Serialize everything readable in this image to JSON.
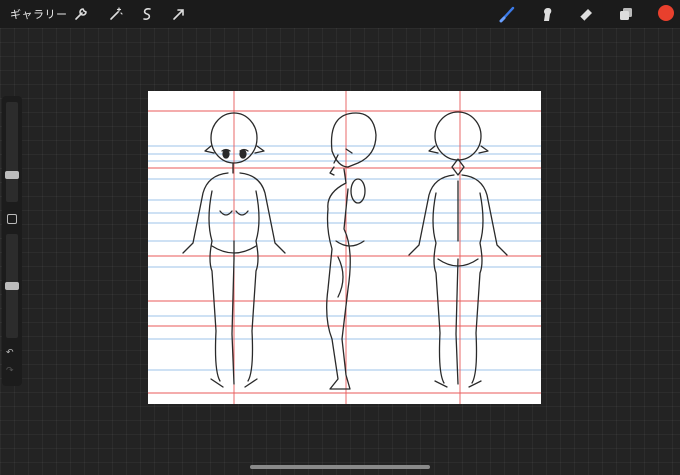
{
  "topbar": {
    "gallery_label": "ギャラリー",
    "tools_left": [
      "wrench-icon",
      "magic-wand-icon",
      "selection-icon",
      "transform-arrow-icon"
    ],
    "tools_right": [
      "brush-icon",
      "smudge-icon",
      "eraser-icon",
      "layers-icon"
    ],
    "active_tool": "brush-icon",
    "accent_color": "#3b7ae8",
    "current_color": "#e8402d"
  },
  "sidebar": {
    "brush_size_level": 0.25,
    "opacity_level": 0.5,
    "undo_icon": "undo-arrow-icon",
    "redo_icon": "redo-arrow-icon"
  },
  "canvas": {
    "guide_colors": {
      "red": "#e85a5a",
      "blue": "#9ec3ea",
      "sketch": "#2a2a2a"
    },
    "figures": [
      "front-view",
      "side-view",
      "back-view"
    ]
  }
}
